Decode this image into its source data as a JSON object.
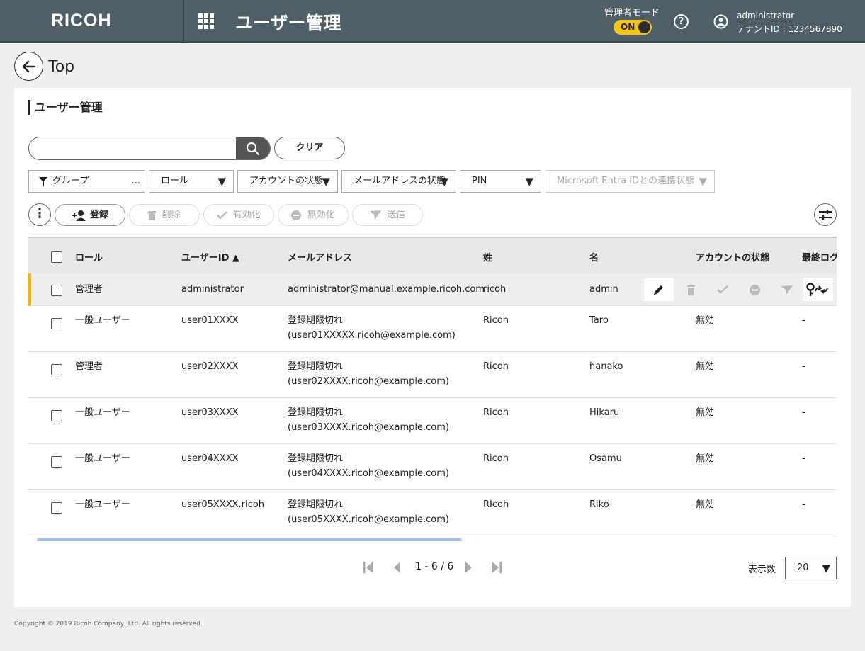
{
  "header": {
    "logo": "RICOH",
    "title": "ユーザー管理",
    "admin_mode_label": "管理者モード",
    "admin_mode_toggle": "ON",
    "user_name": "administrator",
    "tenant_id": "テナントID : 1234567890"
  },
  "back": {
    "label": "Top"
  },
  "section_title": "ユーザー管理",
  "search": {
    "value": "",
    "placeholder": "",
    "clear_label": "クリア"
  },
  "filters": {
    "group": "グループ",
    "group_more": "...",
    "role": "ロール",
    "account_status": "アカウントの状態",
    "mail_status": "メールアドレスの状態",
    "pin": "PIN",
    "entra": "Microsoft Entra IDとの連携状態",
    "arrow": "▼"
  },
  "toolbar": {
    "more": "⋮",
    "register": "登録",
    "delete": "削除",
    "enable": "有効化",
    "disable": "無効化",
    "send": "送信"
  },
  "table": {
    "columns": {
      "role": "ロール",
      "user_id": "ユーザーID ▲",
      "email": "メールアドレス",
      "last_name": "姓",
      "first_name": "名",
      "account_status": "アカウントの状態",
      "last_login": "最終ログ"
    },
    "rows": [
      {
        "role": "管理者",
        "user_id": "administrator",
        "email_line1": "administrator@manual.example.ricoh.com",
        "email_line2": "",
        "last_name": "ricoh",
        "first_name": "admin",
        "status": "",
        "last_login": ""
      },
      {
        "role": "一般ユーザー",
        "user_id": "user01XXXX",
        "email_line1": "登録期限切れ",
        "email_line2": "(user01XXXXX.ricoh@example.com)",
        "last_name": "Ricoh",
        "first_name": "Taro",
        "status": "無効",
        "last_login": "-"
      },
      {
        "role": "管理者",
        "user_id": "user02XXXX",
        "email_line1": "登録期限切れ",
        "email_line2": "(user02XXXX.ricoh@example.com)",
        "last_name": "Ricoh",
        "first_name": "hanako",
        "status": "無効",
        "last_login": "-"
      },
      {
        "role": "一般ユーザー",
        "user_id": "user03XXXX",
        "email_line1": "登録期限切れ",
        "email_line2": "(user03XXXX.ricoh@example.com)",
        "last_name": "Ricoh",
        "first_name": "Hikaru",
        "status": "無効",
        "last_login": "-"
      },
      {
        "role": "一般ユーザー",
        "user_id": "user04XXXX",
        "email_line1": "登録期限切れ",
        "email_line2": "(user04XXXX.ricoh@example.com)",
        "last_name": "Ricoh",
        "first_name": "Osamu",
        "status": "無効",
        "last_login": "-"
      },
      {
        "role": "一般ユーザー",
        "user_id": "user05XXXX.ricoh",
        "email_line1": "登録期限切れ",
        "email_line2": "(user05XXXX.ricoh@example.com)",
        "last_name": "RIcoh",
        "first_name": "Riko",
        "status": "無効",
        "last_login": "-"
      }
    ]
  },
  "pagination": {
    "range": "1 - 6 / 6",
    "per_page_label": "表示数",
    "per_page_value": "20"
  },
  "footer": {
    "copyright": "Copyright © 2019 Ricoh Company, Ltd. All rights reserved."
  },
  "colors": {
    "header_bg": "#4e5f67",
    "toggle_on": "#f5c518",
    "selected_row_marker": "#f5b800",
    "scrollbar": "#a6c0f2"
  }
}
